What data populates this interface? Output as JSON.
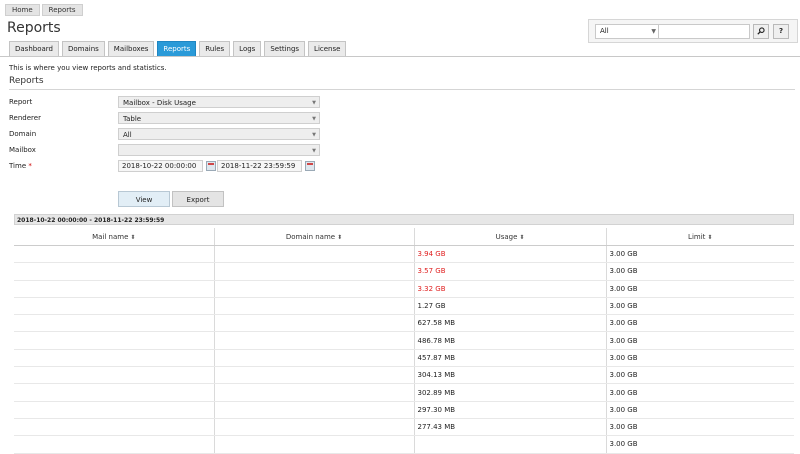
{
  "breadcrumb": [
    "Home",
    "Reports"
  ],
  "page_title": "Reports",
  "search": {
    "scope_value": "All",
    "query_value": "",
    "search_icon": "magnifier-icon",
    "help_label": "?"
  },
  "tabs": [
    {
      "label": "Dashboard",
      "active": false
    },
    {
      "label": "Domains",
      "active": false
    },
    {
      "label": "Mailboxes",
      "active": false
    },
    {
      "label": "Reports",
      "active": true
    },
    {
      "label": "Rules",
      "active": false
    },
    {
      "label": "Logs",
      "active": false
    },
    {
      "label": "Settings",
      "active": false
    },
    {
      "label": "License",
      "active": false
    }
  ],
  "intro_text": "This is where you view reports and statistics.",
  "section_title": "Reports",
  "form": {
    "report_label": "Report",
    "report_value": "Mailbox - Disk Usage",
    "renderer_label": "Renderer",
    "renderer_value": "Table",
    "domain_label": "Domain",
    "domain_value": "All",
    "mailbox_label": "Mailbox",
    "mailbox_value": "",
    "time_label": "Time",
    "time_required_marker": "*",
    "time_from": "2018-10-22 00:00:00",
    "time_to": "2018-11-22 23:59:59"
  },
  "buttons": {
    "view": "View",
    "export": "Export"
  },
  "report": {
    "range_label": "2018-10-22 00:00:00 - 2018-11-22 23:59:59",
    "columns": [
      "Mail name",
      "Domain name",
      "Usage",
      "Limit"
    ],
    "rows": [
      {
        "mail": "",
        "domain": "",
        "usage": "3.94 GB",
        "limit": "3.00 GB",
        "over": true
      },
      {
        "mail": "",
        "domain": "",
        "usage": "3.57 GB",
        "limit": "3.00 GB",
        "over": true
      },
      {
        "mail": "",
        "domain": "",
        "usage": "3.32 GB",
        "limit": "3.00 GB",
        "over": true
      },
      {
        "mail": "",
        "domain": "",
        "usage": "1.27 GB",
        "limit": "3.00 GB",
        "over": false
      },
      {
        "mail": "",
        "domain": "",
        "usage": "627.58 MB",
        "limit": "3.00 GB",
        "over": false
      },
      {
        "mail": "",
        "domain": "",
        "usage": "486.78 MB",
        "limit": "3.00 GB",
        "over": false
      },
      {
        "mail": "",
        "domain": "",
        "usage": "457.87 MB",
        "limit": "3.00 GB",
        "over": false
      },
      {
        "mail": "",
        "domain": "",
        "usage": "304.13 MB",
        "limit": "3.00 GB",
        "over": false
      },
      {
        "mail": "",
        "domain": "",
        "usage": "302.89 MB",
        "limit": "3.00 GB",
        "over": false
      },
      {
        "mail": "",
        "domain": "",
        "usage": "297.30 MB",
        "limit": "3.00 GB",
        "over": false
      },
      {
        "mail": "",
        "domain": "",
        "usage": "277.43 MB",
        "limit": "3.00 GB",
        "over": false
      },
      {
        "mail": "",
        "domain": "",
        "usage": "",
        "limit": "3.00 GB",
        "over": false
      }
    ]
  },
  "colors": {
    "active_tab": "#2a9ad8",
    "over_limit": "#e02020"
  }
}
